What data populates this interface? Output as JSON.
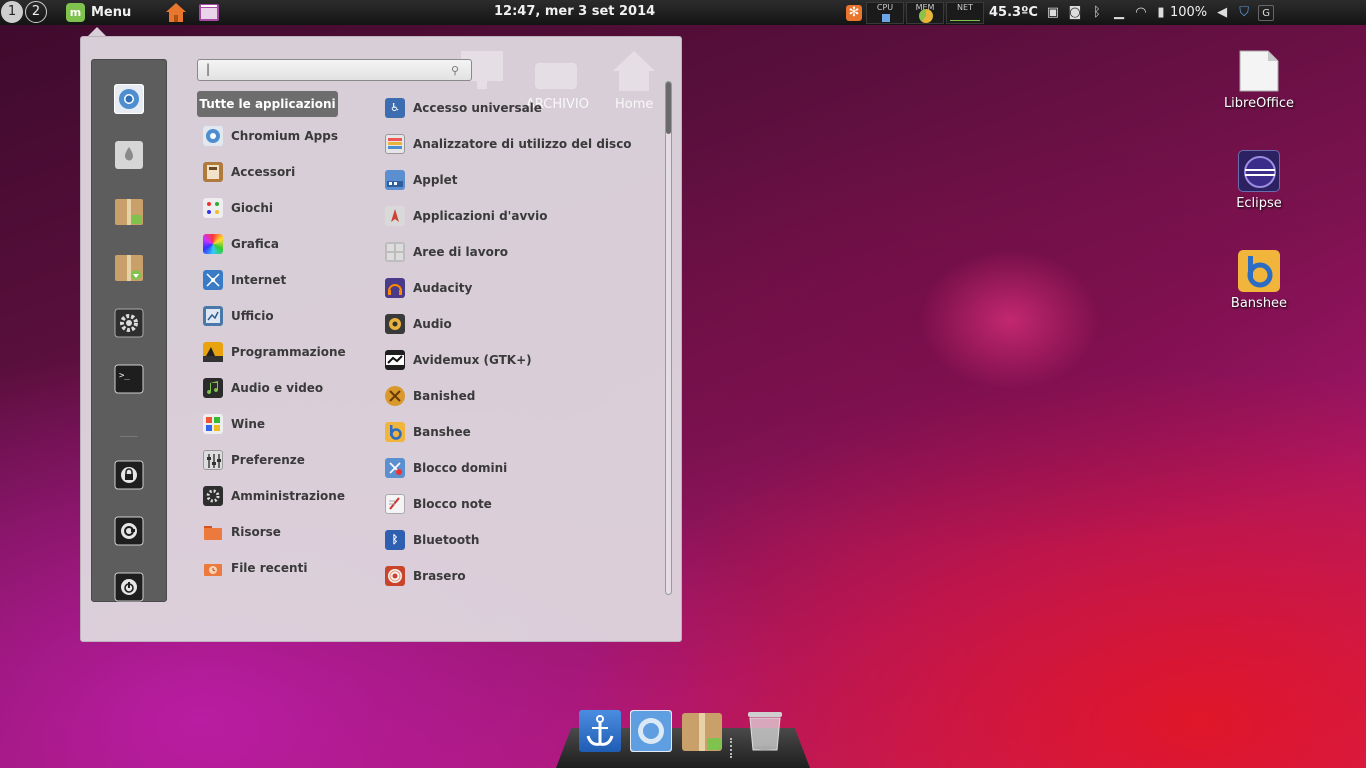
{
  "top_panel": {
    "workspaces": [
      "1",
      "2"
    ],
    "menu_label": "Menu",
    "clock": "12:47, mer  3 set 2014",
    "monitors": [
      "CPU",
      "MEM",
      "NET"
    ],
    "temperature": "45.3ºC",
    "battery": "100%"
  },
  "menu": {
    "search_placeholder": "",
    "all_apps_label": "Tutte le applicazioni",
    "categories": [
      {
        "label": "Chromium Apps",
        "icon": "chromium-icon"
      },
      {
        "label": "Accessori",
        "icon": "calculator-icon"
      },
      {
        "label": "Giochi",
        "icon": "games-icon"
      },
      {
        "label": "Grafica",
        "icon": "graphics-icon"
      },
      {
        "label": "Internet",
        "icon": "internet-icon"
      },
      {
        "label": "Ufficio",
        "icon": "office-icon"
      },
      {
        "label": "Programmazione",
        "icon": "programming-icon"
      },
      {
        "label": "Audio e video",
        "icon": "audio-video-icon"
      },
      {
        "label": "Wine",
        "icon": "wine-icon"
      },
      {
        "label": "Preferenze",
        "icon": "preferences-icon"
      },
      {
        "label": "Amministrazione",
        "icon": "administration-icon"
      },
      {
        "label": "Risorse",
        "icon": "folder-icon"
      },
      {
        "label": "File recenti",
        "icon": "recent-files-icon"
      }
    ],
    "apps": [
      {
        "label": "Accesso universale",
        "icon": "accessibility-icon"
      },
      {
        "label": "Analizzatore di utilizzo del disco",
        "icon": "disk-usage-icon"
      },
      {
        "label": "Applet",
        "icon": "applet-icon"
      },
      {
        "label": "Applicazioni d'avvio",
        "icon": "startup-apps-icon"
      },
      {
        "label": "Aree di lavoro",
        "icon": "workspaces-icon"
      },
      {
        "label": "Audacity",
        "icon": "audacity-icon"
      },
      {
        "label": "Audio",
        "icon": "speaker-icon"
      },
      {
        "label": "Avidemux (GTK+)",
        "icon": "avidemux-icon"
      },
      {
        "label": "Banished",
        "icon": "banished-icon"
      },
      {
        "label": "Banshee",
        "icon": "banshee-icon"
      },
      {
        "label": "Blocco domini",
        "icon": "domain-block-icon"
      },
      {
        "label": "Blocco note",
        "icon": "notepad-icon"
      },
      {
        "label": "Bluetooth",
        "icon": "bluetooth-icon"
      },
      {
        "label": "Brasero",
        "icon": "brasero-icon"
      }
    ],
    "ghost_labels": [
      "ARCHIVIO",
      "Home"
    ]
  },
  "desktop_icons": [
    {
      "label": "LibreOffice",
      "icon": "libreoffice-icon"
    },
    {
      "label": "Eclipse",
      "icon": "eclipse-icon"
    },
    {
      "label": "Banshee",
      "icon": "banshee-icon"
    }
  ],
  "colors": {
    "menu_bg": "#ded6de",
    "fav_bar_bg": "#5d5d5d",
    "mint_green": "#7fc24e",
    "panel_bg": "#141414"
  }
}
